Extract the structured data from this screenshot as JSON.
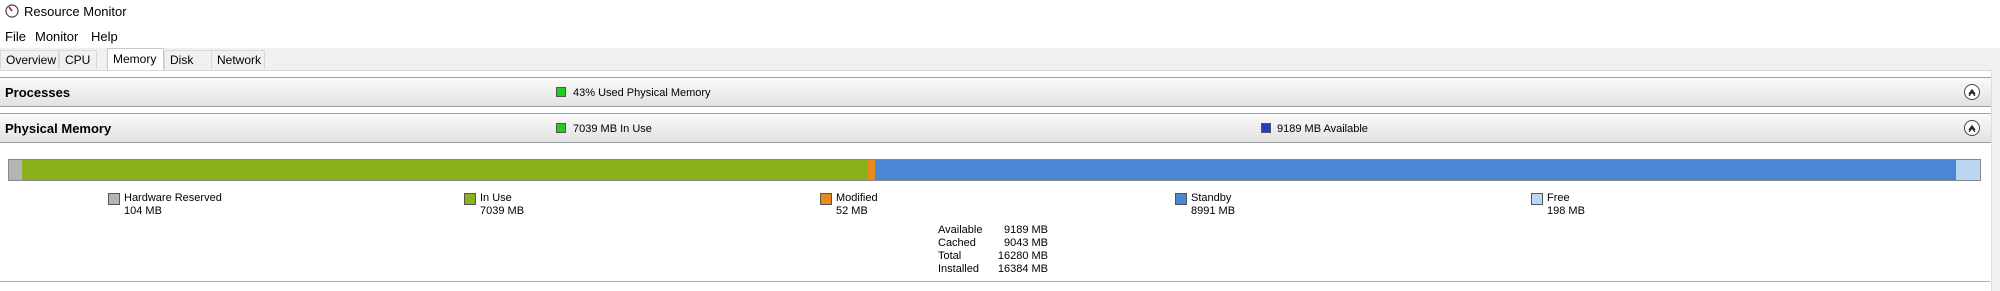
{
  "window": {
    "title": "Resource Monitor"
  },
  "menu": [
    "File",
    "Monitor",
    "Help"
  ],
  "tabs": [
    {
      "label": "Overview"
    },
    {
      "label": "CPU"
    },
    {
      "label": "Memory",
      "active": true
    },
    {
      "label": "Disk"
    },
    {
      "label": "Network"
    }
  ],
  "processes": {
    "title": "Processes",
    "status": "43% Used Physical Memory",
    "status_color": "#1fcc1f"
  },
  "physical_memory": {
    "title": "Physical Memory",
    "in_use_status": "7039 MB In Use",
    "in_use_color": "#1fcc1f",
    "available_status": "9189 MB Available",
    "available_color": "#1f40cc",
    "bar": [
      {
        "name": "hardware-reserved",
        "mb": 104,
        "color": "#b4b4b4"
      },
      {
        "name": "in-use",
        "mb": 7039,
        "color": "#8bb21c"
      },
      {
        "name": "modified",
        "mb": 52,
        "color": "#e88a1c"
      },
      {
        "name": "standby",
        "mb": 8991,
        "color": "#4a86d4"
      },
      {
        "name": "free",
        "mb": 198,
        "color": "#bad6f2"
      }
    ],
    "legend": [
      {
        "label": "Hardware Reserved",
        "value": "104 MB",
        "color": "#b4b4b4"
      },
      {
        "label": "In Use",
        "value": "7039 MB",
        "color": "#8bb21c"
      },
      {
        "label": "Modified",
        "value": "52 MB",
        "color": "#e88a1c"
      },
      {
        "label": "Standby",
        "value": "8991 MB",
        "color": "#4a86d4"
      },
      {
        "label": "Free",
        "value": "198 MB",
        "color": "#bad6f2"
      }
    ],
    "stats": [
      {
        "label": "Available",
        "value": "9189 MB"
      },
      {
        "label": "Cached",
        "value": "9043 MB"
      },
      {
        "label": "Total",
        "value": "16280 MB"
      },
      {
        "label": "Installed",
        "value": "16384 MB"
      }
    ]
  }
}
